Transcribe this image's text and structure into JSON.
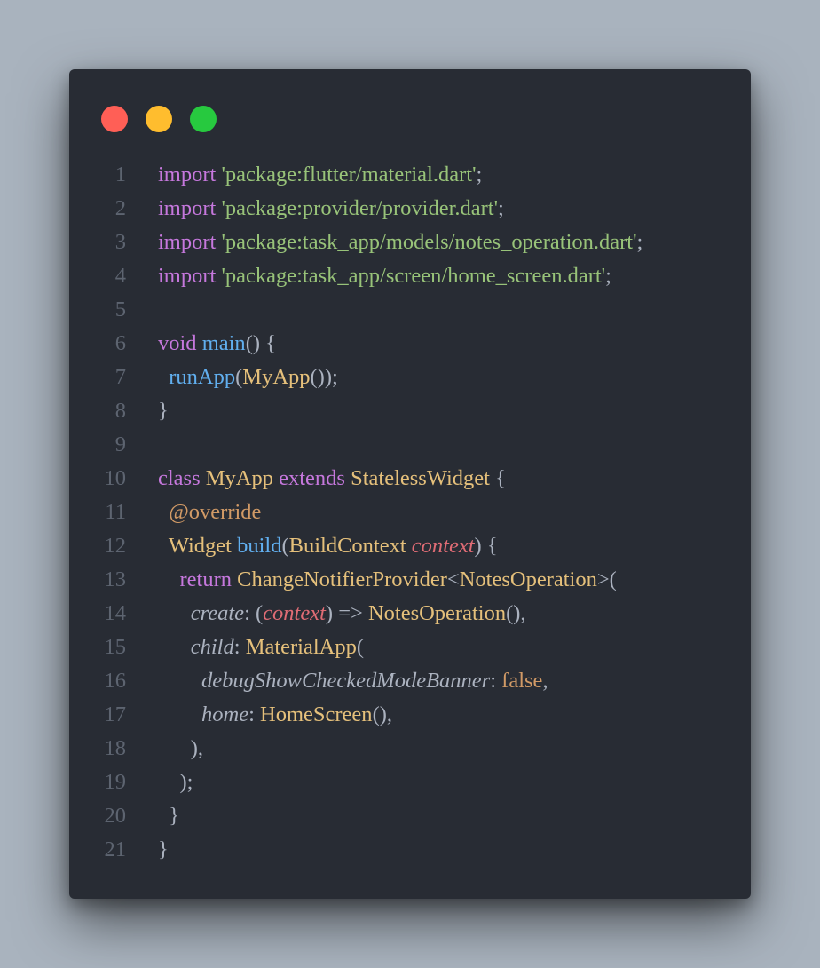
{
  "window": {
    "controls": {
      "close_color": "#ff5f56",
      "minimize_color": "#ffbd2e",
      "maximize_color": "#27c93f"
    }
  },
  "code": {
    "lines": [
      {
        "n": "1",
        "tokens": [
          [
            "kw",
            "import"
          ],
          [
            "p",
            " "
          ],
          [
            "str",
            "'package:flutter/material.dart'"
          ],
          [
            "p",
            ";"
          ]
        ]
      },
      {
        "n": "2",
        "tokens": [
          [
            "kw",
            "import"
          ],
          [
            "p",
            " "
          ],
          [
            "str",
            "'package:provider/provider.dart'"
          ],
          [
            "p",
            ";"
          ]
        ]
      },
      {
        "n": "3",
        "tokens": [
          [
            "kw",
            "import"
          ],
          [
            "p",
            " "
          ],
          [
            "str",
            "'package:task_app/models/notes_operation.dart'"
          ],
          [
            "p",
            ";"
          ]
        ]
      },
      {
        "n": "4",
        "tokens": [
          [
            "kw",
            "import"
          ],
          [
            "p",
            " "
          ],
          [
            "str",
            "'package:task_app/screen/home_screen.dart'"
          ],
          [
            "p",
            ";"
          ]
        ]
      },
      {
        "n": "5",
        "tokens": []
      },
      {
        "n": "6",
        "tokens": [
          [
            "kw",
            "void"
          ],
          [
            "p",
            " "
          ],
          [
            "fn",
            "main"
          ],
          [
            "p",
            "() {"
          ]
        ]
      },
      {
        "n": "7",
        "tokens": [
          [
            "p",
            "  "
          ],
          [
            "fn",
            "runApp"
          ],
          [
            "p",
            "("
          ],
          [
            "cls",
            "MyApp"
          ],
          [
            "p",
            "());"
          ]
        ]
      },
      {
        "n": "8",
        "tokens": [
          [
            "p",
            "}"
          ]
        ]
      },
      {
        "n": "9",
        "tokens": []
      },
      {
        "n": "10",
        "tokens": [
          [
            "kw",
            "class"
          ],
          [
            "p",
            " "
          ],
          [
            "cls",
            "MyApp"
          ],
          [
            "p",
            " "
          ],
          [
            "kw",
            "extends"
          ],
          [
            "p",
            " "
          ],
          [
            "cls",
            "StatelessWidget"
          ],
          [
            "p",
            " {"
          ]
        ]
      },
      {
        "n": "11",
        "tokens": [
          [
            "p",
            "  "
          ],
          [
            "ann",
            "@override"
          ]
        ]
      },
      {
        "n": "12",
        "tokens": [
          [
            "p",
            "  "
          ],
          [
            "cls",
            "Widget"
          ],
          [
            "p",
            " "
          ],
          [
            "fn",
            "build"
          ],
          [
            "p",
            "("
          ],
          [
            "cls",
            "BuildContext"
          ],
          [
            "p",
            " "
          ],
          [
            "par",
            "context"
          ],
          [
            "p",
            ") {"
          ]
        ]
      },
      {
        "n": "13",
        "tokens": [
          [
            "p",
            "    "
          ],
          [
            "kw",
            "return"
          ],
          [
            "p",
            " "
          ],
          [
            "cls",
            "ChangeNotifierProvider"
          ],
          [
            "p",
            "<"
          ],
          [
            "cls",
            "NotesOperation"
          ],
          [
            "p",
            ">("
          ]
        ]
      },
      {
        "n": "14",
        "tokens": [
          [
            "p",
            "      "
          ],
          [
            "named",
            "create"
          ],
          [
            "p",
            ": ("
          ],
          [
            "par",
            "context"
          ],
          [
            "p",
            ") => "
          ],
          [
            "cls",
            "NotesOperation"
          ],
          [
            "p",
            "(),"
          ]
        ]
      },
      {
        "n": "15",
        "tokens": [
          [
            "p",
            "      "
          ],
          [
            "named",
            "child"
          ],
          [
            "p",
            ": "
          ],
          [
            "cls",
            "MaterialApp"
          ],
          [
            "p",
            "("
          ]
        ]
      },
      {
        "n": "16",
        "tokens": [
          [
            "p",
            "        "
          ],
          [
            "named",
            "debugShowCheckedModeBanner"
          ],
          [
            "p",
            ": "
          ],
          [
            "bool",
            "false"
          ],
          [
            "p",
            ","
          ]
        ]
      },
      {
        "n": "17",
        "tokens": [
          [
            "p",
            "        "
          ],
          [
            "named",
            "home"
          ],
          [
            "p",
            ": "
          ],
          [
            "cls",
            "HomeScreen"
          ],
          [
            "p",
            "(),"
          ]
        ]
      },
      {
        "n": "18",
        "tokens": [
          [
            "p",
            "      ),"
          ]
        ]
      },
      {
        "n": "19",
        "tokens": [
          [
            "p",
            "    );"
          ]
        ]
      },
      {
        "n": "20",
        "tokens": [
          [
            "p",
            "  }"
          ]
        ]
      },
      {
        "n": "21",
        "tokens": [
          [
            "p",
            "}"
          ]
        ]
      }
    ]
  }
}
